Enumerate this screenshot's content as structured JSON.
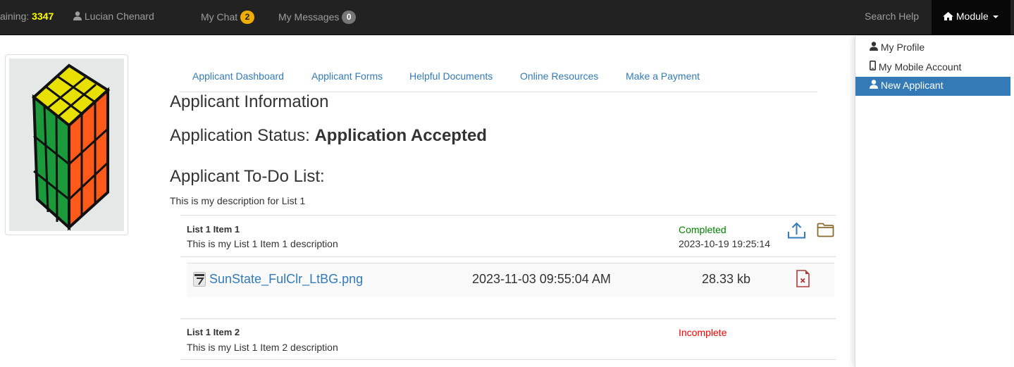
{
  "nav": {
    "remaining_label": "aining:",
    "remaining_value": "3347",
    "user": "Lucian Chenard",
    "chat": "My Chat",
    "chat_count": "2",
    "messages": "My Messages",
    "messages_count": "0",
    "search_help": "Search Help",
    "module": "Module"
  },
  "colors": {
    "navbar": "#222222",
    "link": "#337ab7",
    "completed": "#008000",
    "incomplete": "#ff0000",
    "chat_badge": "#f0ad00",
    "active_menu": "#337ab7"
  },
  "dropdown": {
    "items": [
      {
        "label": "My Profile",
        "icon": "user-tie-icon"
      },
      {
        "label": "My Mobile Account",
        "icon": "mobile-icon"
      },
      {
        "label": "New Applicant",
        "icon": "user-tie-icon",
        "active": true
      }
    ]
  },
  "tabs": [
    "Applicant Dashboard",
    "Applicant Forms",
    "Helpful Documents",
    "Online Resources",
    "Make a Payment"
  ],
  "main": {
    "title": "Applicant Information",
    "status_label": "Application Status:",
    "status_value": "Application Accepted",
    "todo_title": "Applicant To-Do List:",
    "list_desc": "This is my description for List 1"
  },
  "items": [
    {
      "title": "List 1 Item 1",
      "desc": "This is my List 1 Item 1 description",
      "status": "Completed",
      "date": "2023-10-19 19:25:14"
    },
    {
      "title": "List 1 Item 2",
      "desc": "This is my List 1 Item 2 description",
      "status": "Incomplete"
    }
  ],
  "file": {
    "name": "SunState_FulClr_LtBG.png",
    "date": "2023-11-03 09:55:04 AM",
    "size": "28.33 kb"
  }
}
